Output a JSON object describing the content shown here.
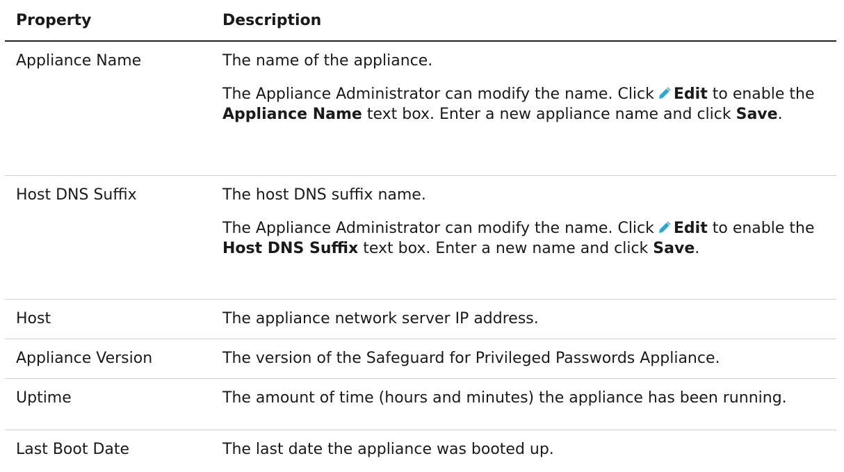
{
  "table": {
    "headers": {
      "property": "Property",
      "description": "Description"
    },
    "rows": [
      {
        "property": "Appliance Name",
        "desc_line1": "The name of the appliance.",
        "desc_p2_a": "The Appliance Administrator can modify the name. Click",
        "desc_p2_edit": "Edit",
        "desc_p2_b": "to enable the",
        "desc_p2_field": "Appliance Name",
        "desc_p2_c": "text box. Enter a new appliance name and click",
        "desc_p2_save": "Save",
        "desc_p2_end": "."
      },
      {
        "property": "Host DNS Suffix",
        "desc_line1": "The host DNS suffix name.",
        "desc_p2_a": "The Appliance Administrator can modify the name. Click",
        "desc_p2_edit": "Edit",
        "desc_p2_b": "to enable the",
        "desc_p2_field": "Host DNS Suffix",
        "desc_p2_c": "text box. Enter a new name and click",
        "desc_p2_save": "Save",
        "desc_p2_end": "."
      },
      {
        "property": "Host",
        "description": "The appliance network server IP address."
      },
      {
        "property": "Appliance Version",
        "description": "The version of the Safeguard for Privileged Passwords Appliance."
      },
      {
        "property": "Uptime",
        "description": "The amount of time (hours and minutes) the appliance has been running."
      },
      {
        "property": "Last Boot Date",
        "description": "The last date the appliance was booted up."
      }
    ]
  },
  "icons": {
    "edit": "pencil-icon"
  },
  "colors": {
    "text": "#1a1a1a",
    "header_rule": "#222222",
    "row_rule": "#cfcfcf",
    "pencil": "#2aa7d9"
  }
}
